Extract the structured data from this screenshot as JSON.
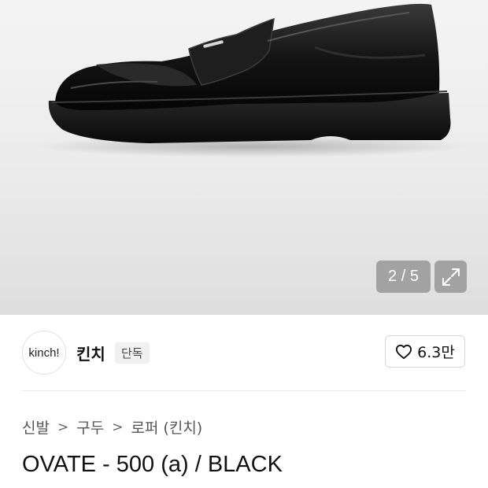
{
  "gallery": {
    "counter": "2 / 5",
    "current": 2,
    "total": 5
  },
  "shop": {
    "logo_text": "kinch!",
    "name": "킨치",
    "badge": "단독",
    "likes": "6.3만"
  },
  "breadcrumb": [
    "신발",
    "구두",
    "로퍼 (킨치)"
  ],
  "product": {
    "title": "OVATE - 500 (a) / BLACK"
  },
  "icons": {
    "expand": "expand-icon",
    "heart": "heart-icon",
    "chevron": "chevron-right-icon"
  },
  "colors": {
    "text": "#111111",
    "muted": "#555555",
    "overlay": "#969696"
  }
}
